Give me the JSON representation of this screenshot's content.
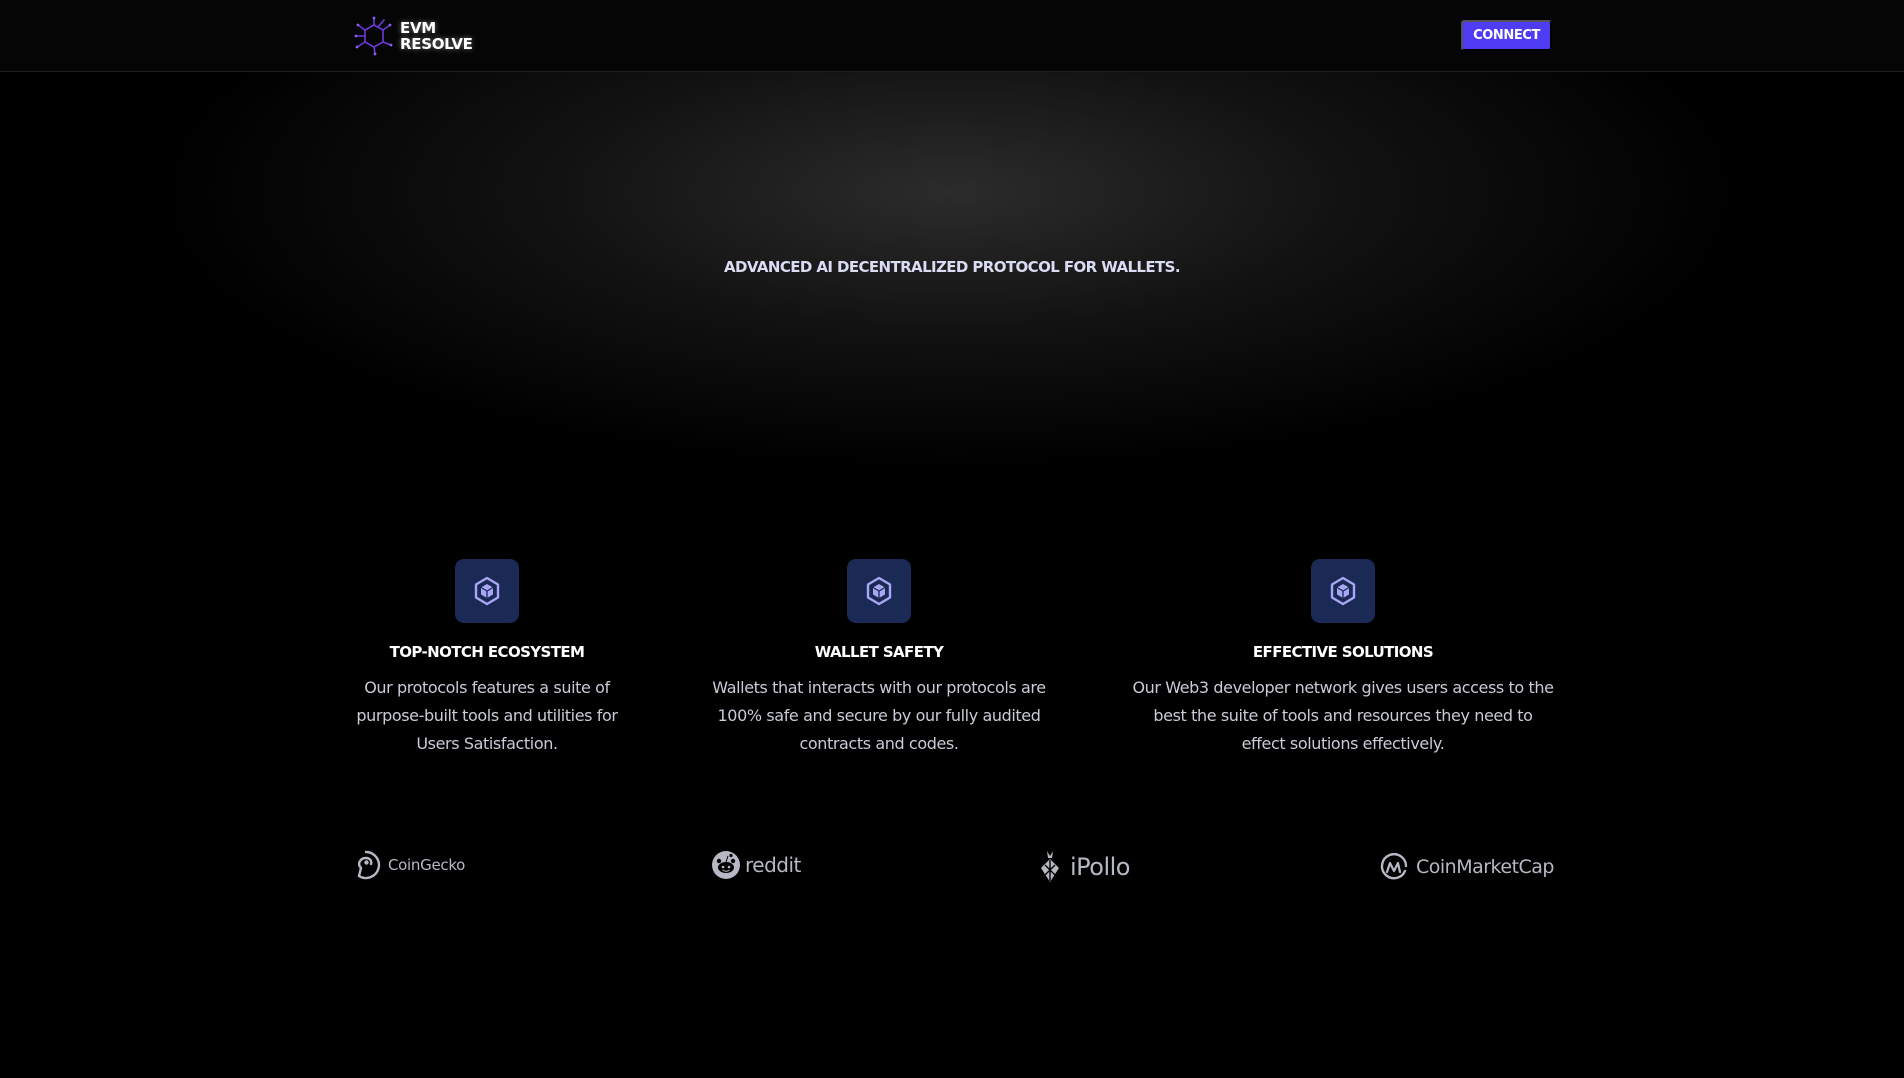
{
  "header": {
    "logo_line1": "EVM",
    "logo_line2": "RESOLVE",
    "connect_label": "CONNECT"
  },
  "hero": {
    "title": "ADVANCED AI DECENTRALIZED PROTOCOL FOR WALLETS."
  },
  "features": [
    {
      "icon": "cube-hexagon-icon",
      "title": "TOP-NOTCH ECOSYSTEM",
      "description": "Our protocols features a suite of purpose-built tools and utilities for Users Satisfaction."
    },
    {
      "icon": "cube-hexagon-icon",
      "title": "WALLET SAFETY",
      "description": "Wallets that interacts with our protocols are 100% safe and secure by our fully audited contracts and codes."
    },
    {
      "icon": "cube-hexagon-icon",
      "title": "EFFECTIVE SOLUTIONS",
      "description": "Our Web3 developer network gives users access to the best the suite of tools and resources they need to effect solutions effectively."
    }
  ],
  "partners": [
    {
      "name": "CoinGecko",
      "icon": "coingecko-logo-icon"
    },
    {
      "name": "reddit",
      "icon": "reddit-logo-icon"
    },
    {
      "name": "iPollo",
      "icon": "ipollo-logo-icon"
    },
    {
      "name": "CoinMarketCap",
      "icon": "coinmarketcap-logo-icon"
    }
  ],
  "colors": {
    "background": "#000000",
    "accent": "#4f3cf3",
    "icon_tile": "#1a2a55",
    "icon_glyph": "#a9a6f5",
    "logo_purple": "#6b3ad6",
    "partner_gray": "#b6b8c3"
  }
}
